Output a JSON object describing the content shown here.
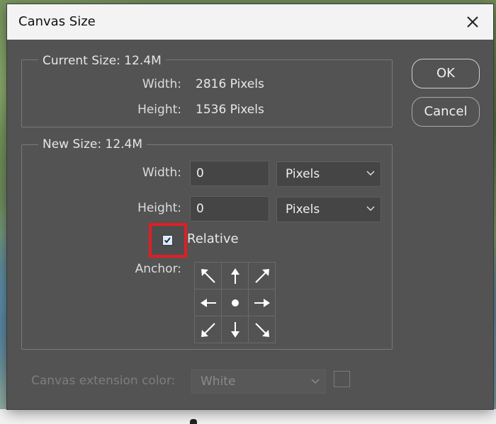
{
  "dialog": {
    "title": "Canvas Size"
  },
  "current_size": {
    "legend": "Current Size: 12.4M",
    "width_label": "Width:",
    "width_value": "2816 Pixels",
    "height_label": "Height:",
    "height_value": "1536 Pixels"
  },
  "new_size": {
    "legend": "New Size: 12.4M",
    "width_label": "Width:",
    "width_value": "0",
    "width_unit": "Pixels",
    "height_label": "Height:",
    "height_value": "0",
    "height_unit": "Pixels",
    "relative_label": "Relative",
    "relative_checked": true,
    "anchor_label": "Anchor:"
  },
  "buttons": {
    "ok": "OK",
    "cancel": "Cancel"
  },
  "extension": {
    "label": "Canvas extension color:",
    "value": "White"
  },
  "colors": {
    "dialog_bg": "#535353",
    "highlight": "#e01e24",
    "titlebar": "#f3f3f3"
  }
}
